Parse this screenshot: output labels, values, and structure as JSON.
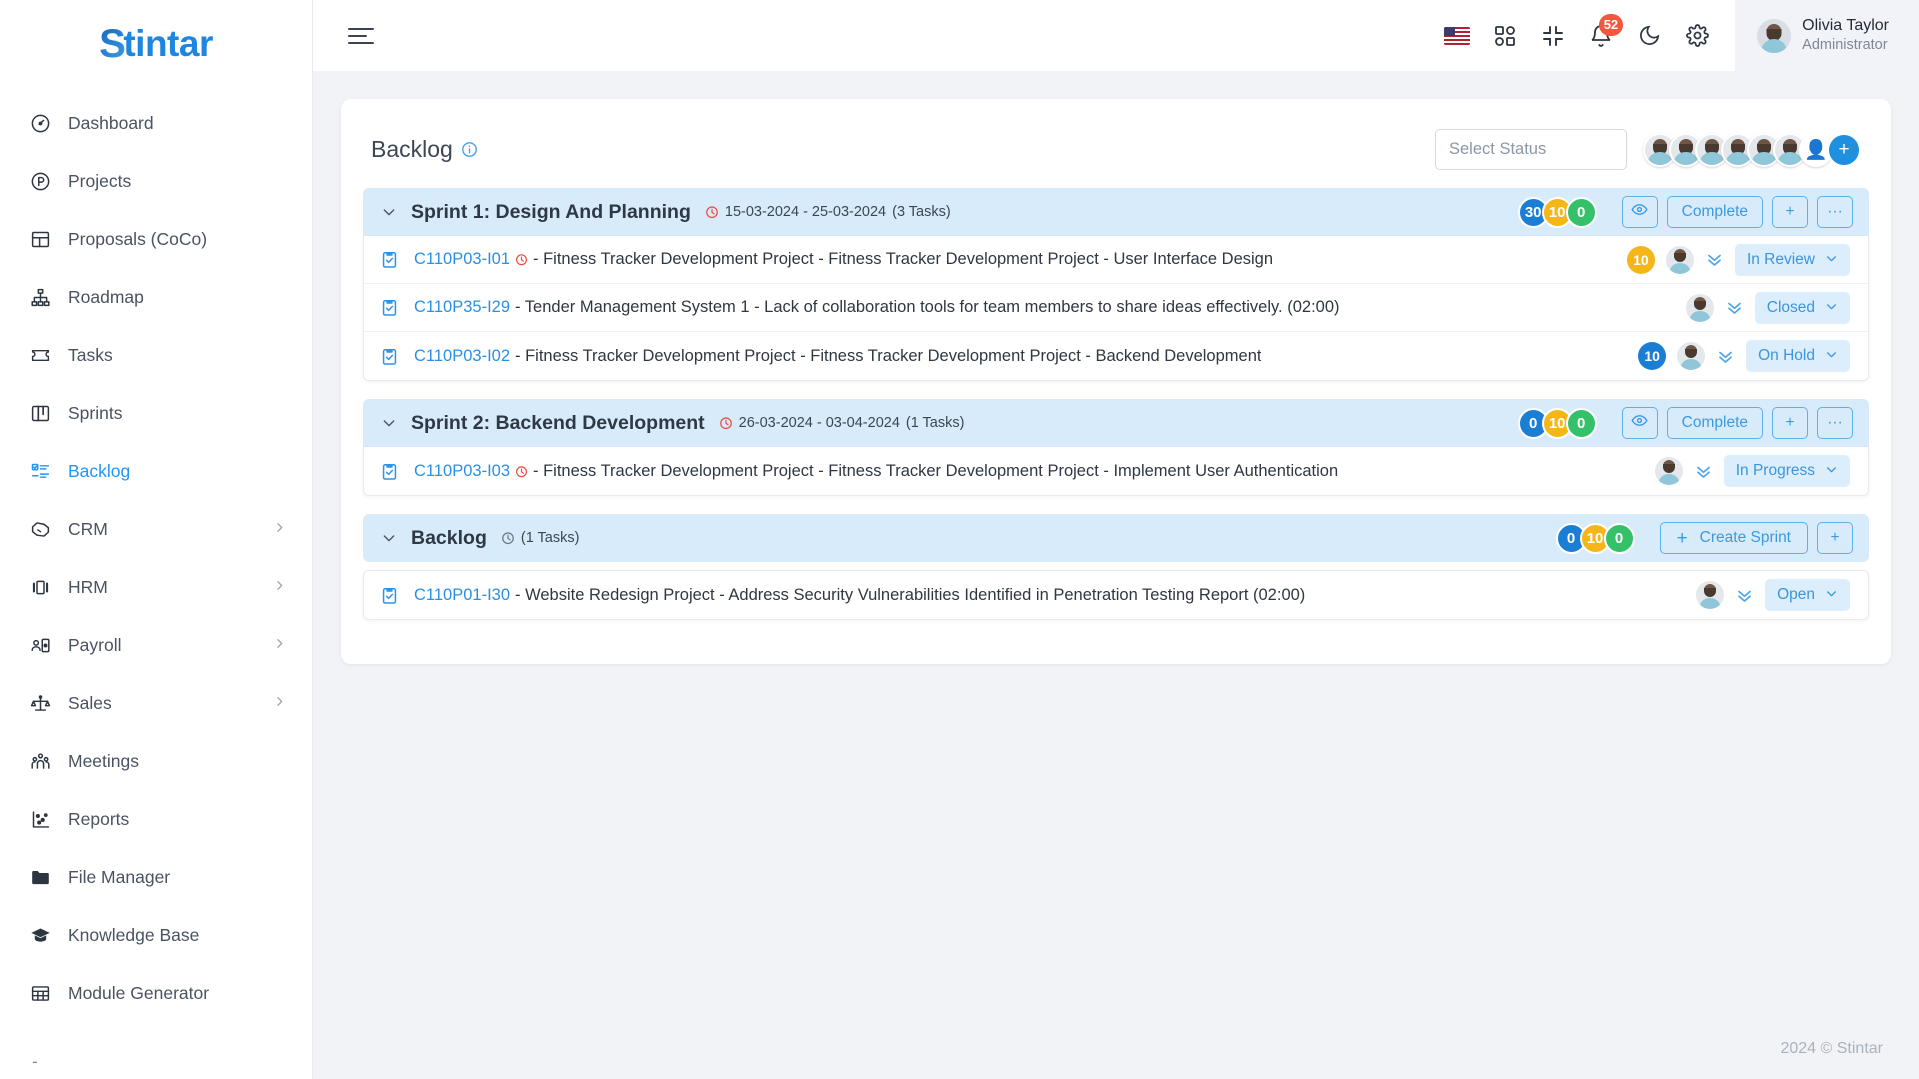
{
  "brand": {
    "logo_s": "S",
    "logo_rest": "tintar",
    "accent": "#2196f3"
  },
  "sidebar": {
    "items": [
      {
        "label": "Dashboard",
        "icon": "gauge-icon",
        "active": false,
        "expandable": false
      },
      {
        "label": "Projects",
        "icon": "circle-p-icon",
        "active": false,
        "expandable": false
      },
      {
        "label": "Proposals (CoCo)",
        "icon": "layout-icon",
        "active": false,
        "expandable": false
      },
      {
        "label": "Roadmap",
        "icon": "sitemap-icon",
        "active": false,
        "expandable": false
      },
      {
        "label": "Tasks",
        "icon": "ticket-icon",
        "active": false,
        "expandable": false
      },
      {
        "label": "Sprints",
        "icon": "board-icon",
        "active": false,
        "expandable": false
      },
      {
        "label": "Backlog",
        "icon": "checklist-icon",
        "active": true,
        "expandable": false
      },
      {
        "label": "CRM",
        "icon": "handshake-icon",
        "active": false,
        "expandable": true
      },
      {
        "label": "HRM",
        "icon": "carousel-icon",
        "active": false,
        "expandable": true
      },
      {
        "label": "Payroll",
        "icon": "id-card-icon",
        "active": false,
        "expandable": true
      },
      {
        "label": "Sales",
        "icon": "scales-icon",
        "active": false,
        "expandable": true
      },
      {
        "label": "Meetings",
        "icon": "people-icon",
        "active": false,
        "expandable": false
      },
      {
        "label": "Reports",
        "icon": "scatter-icon",
        "active": false,
        "expandable": false
      },
      {
        "label": "File Manager",
        "icon": "folder-icon",
        "active": false,
        "expandable": false
      },
      {
        "label": "Knowledge Base",
        "icon": "graduation-cap-icon",
        "active": false,
        "expandable": false
      },
      {
        "label": "Module Generator",
        "icon": "grid-table-icon",
        "active": false,
        "expandable": false
      }
    ],
    "trailing_dash": "-"
  },
  "topbar": {
    "menu_toggle": "hamburger-icon",
    "language_flag": "us-flag-icon",
    "apps": "apps-grid-icon",
    "fullscreen": "collapse-screen-icon",
    "notifications_icon": "bell-icon",
    "notifications_count": "52",
    "theme": "moon-icon",
    "settings": "gear-icon",
    "user": {
      "name": "Olivia Taylor",
      "role": "Administrator"
    }
  },
  "page": {
    "title": "Backlog",
    "info_icon": "info-icon",
    "select_status_placeholder": "Select Status",
    "member_avatars": 6,
    "add_member_label": "+"
  },
  "groups": [
    {
      "name": "Sprint 1: Design And Planning",
      "date_range": "15-03-2024 - 25-03-2024",
      "task_count_label": "(3 Tasks)",
      "clock": "red",
      "pills": [
        {
          "value": "30",
          "color": "blue"
        },
        {
          "value": "10",
          "color": "amber"
        },
        {
          "value": "0",
          "color": "green"
        }
      ],
      "buttons": {
        "eye": "eye-icon",
        "complete": "Complete",
        "add": "+",
        "more": "···"
      },
      "type": "sprint",
      "tasks": [
        {
          "key": "C110P03-I01",
          "has_clock": true,
          "text": "- Fitness Tracker Development Project - Fitness Tracker Development Project - User Interface Design",
          "points": "10",
          "points_color": "amber",
          "status": "In Review"
        },
        {
          "key": "C110P35-I29",
          "has_clock": false,
          "text": "- Tender Management System 1 - Lack of collaboration tools for team members to share ideas effectively. (02:00)",
          "points": "",
          "points_color": "",
          "status": "Closed"
        },
        {
          "key": "C110P03-I02",
          "has_clock": false,
          "text": "- Fitness Tracker Development Project - Fitness Tracker Development Project - Backend Development",
          "points": "10",
          "points_color": "blue",
          "status": "On Hold"
        }
      ]
    },
    {
      "name": "Sprint 2: Backend Development",
      "date_range": "26-03-2024 - 03-04-2024",
      "task_count_label": "(1 Tasks)",
      "clock": "red",
      "pills": [
        {
          "value": "0",
          "color": "blue"
        },
        {
          "value": "10",
          "color": "amber"
        },
        {
          "value": "0",
          "color": "green"
        }
      ],
      "buttons": {
        "eye": "eye-icon",
        "complete": "Complete",
        "add": "+",
        "more": "···"
      },
      "type": "sprint",
      "tasks": [
        {
          "key": "C110P03-I03",
          "has_clock": true,
          "text": "- Fitness Tracker Development Project - Fitness Tracker Development Project - Implement User Authentication",
          "points": "",
          "points_color": "",
          "status": "In Progress"
        }
      ]
    },
    {
      "name": "Backlog",
      "date_range": "",
      "task_count_label": "(1 Tasks)",
      "clock": "grey",
      "pills": [
        {
          "value": "0",
          "color": "blue"
        },
        {
          "value": "10",
          "color": "amber"
        },
        {
          "value": "0",
          "color": "green"
        }
      ],
      "buttons": {
        "create_sprint": "Create Sprint",
        "add": "+"
      },
      "type": "backlog",
      "tasks": [
        {
          "key": "C110P01-I30",
          "has_clock": false,
          "text": "- Website Redesign Project - Address Security Vulnerabilities Identified in Penetration Testing Report (02:00)",
          "points": "",
          "points_color": "",
          "status": "Open"
        }
      ]
    }
  ],
  "footer": {
    "copyright": "2024 © Stintar"
  }
}
